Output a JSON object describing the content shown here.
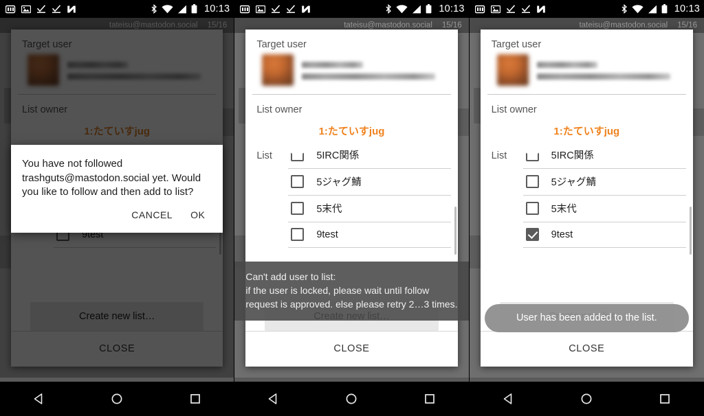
{
  "status_bar": {
    "icons": [
      "battery-saver-icon",
      "image-icon",
      "check-download-icon",
      "check-download-icon-2",
      "n-app-icon"
    ],
    "right_icons": [
      "bluetooth-icon",
      "wifi-icon",
      "signal-icon",
      "battery-icon"
    ],
    "time": "10:13"
  },
  "app_header": {
    "account": "tateisu@mastodon.social",
    "counter": "15/16"
  },
  "dialog": {
    "target_user_label": "Target user",
    "list_owner_label": "List owner",
    "list_owner_value": "1:たていすjug",
    "list_label": "List",
    "create_new_list": "Create new list…",
    "close": "CLOSE",
    "items": [
      {
        "label": "5IRC関係",
        "checked": false
      },
      {
        "label": "5ジャグ鯖",
        "checked": false
      },
      {
        "label": "5末代",
        "checked": false
      },
      {
        "label": "9test",
        "checked": false
      }
    ],
    "items_checked_last": [
      {
        "label": "5IRC関係",
        "checked": false
      },
      {
        "label": "5ジャグ鯖",
        "checked": false
      },
      {
        "label": "5末代",
        "checked": false
      },
      {
        "label": "9test",
        "checked": true
      }
    ]
  },
  "panel1": {
    "alert": {
      "message": "You have not followed trashguts@mastodon.social yet. Would you like to follow and then add to list?",
      "cancel": "CANCEL",
      "ok": "OK"
    },
    "visible_item": "9test"
  },
  "panel2": {
    "toast": "Can't add user to list:\nif the user is locked, please wait until follow request is approved. else please retry 2…3 times."
  },
  "panel3": {
    "toast": "User has been added to the list."
  },
  "nav_bar": {
    "back": "back-icon",
    "home": "home-icon",
    "recents": "recents-icon"
  },
  "colors": {
    "accent_orange": "#F0821E",
    "dialog_bg": "#FFFFFF",
    "page_bg": "#6F6F6F",
    "status_bar_bg": "#000000"
  }
}
